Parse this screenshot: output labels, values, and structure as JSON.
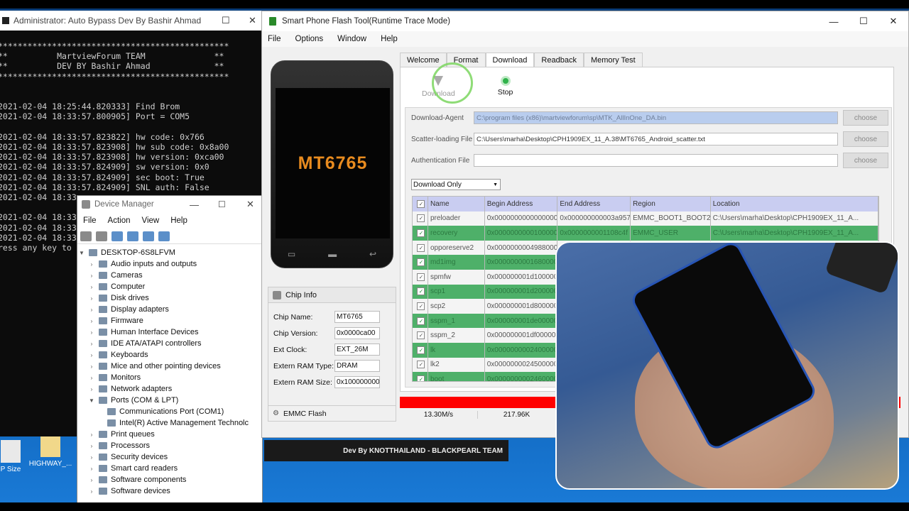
{
  "console": {
    "title": "Administrator: Auto Bypass Dev By Bashir Ahmad",
    "lines": [
      "***********************************************",
      "**          MartviewForum TEAM              **",
      "**          DEV BY Bashir Ahmad             **",
      "***********************************************",
      "",
      "",
      "2021-02-04 18:25:44.820333] Find Brom",
      "2021-02-04 18:33:57.800905] Port = COM5",
      "",
      "2021-02-04 18:33:57.823822] hw code: 0x766",
      "2021-02-04 18:33:57.823908] hw sub code: 0x8a00",
      "2021-02-04 18:33:57.823908] hw version: 0xca00",
      "2021-02-04 18:33:57.824909] sw version: 0x0",
      "2021-02-04 18:33:57.824909] sec boot: True",
      "2021-02-04 18:33:57.824909] SNL auth: False",
      "2021-02-04 18:33",
      "",
      "2021-02-04 18:33",
      "2021-02-04 18:33",
      "2021-02-04 18:33",
      "ress any key to"
    ]
  },
  "devmgr": {
    "title": "Device Manager",
    "menu": [
      "File",
      "Action",
      "View",
      "Help"
    ],
    "root": "DESKTOP-6S8LFVM",
    "items": [
      {
        "label": "Audio inputs and outputs",
        "expanded": false
      },
      {
        "label": "Cameras",
        "expanded": false
      },
      {
        "label": "Computer",
        "expanded": false
      },
      {
        "label": "Disk drives",
        "expanded": false
      },
      {
        "label": "Display adapters",
        "expanded": false
      },
      {
        "label": "Firmware",
        "expanded": false
      },
      {
        "label": "Human Interface Devices",
        "expanded": false
      },
      {
        "label": "IDE ATA/ATAPI controllers",
        "expanded": false
      },
      {
        "label": "Keyboards",
        "expanded": false
      },
      {
        "label": "Mice and other pointing devices",
        "expanded": false
      },
      {
        "label": "Monitors",
        "expanded": false
      },
      {
        "label": "Network adapters",
        "expanded": false
      },
      {
        "label": "Ports (COM & LPT)",
        "expanded": true
      },
      {
        "label": "Communications Port (COM1)",
        "child": true
      },
      {
        "label": "Intel(R) Active Management Technolc",
        "child": true
      },
      {
        "label": "Print queues",
        "expanded": false
      },
      {
        "label": "Processors",
        "expanded": false
      },
      {
        "label": "Security devices",
        "expanded": false
      },
      {
        "label": "Smart card readers",
        "expanded": false
      },
      {
        "label": "Software components",
        "expanded": false
      },
      {
        "label": "Software devices",
        "expanded": false
      }
    ]
  },
  "flash": {
    "title": "Smart Phone Flash Tool(Runtime Trace Mode)",
    "menu": [
      "File",
      "Options",
      "Window",
      "Help"
    ],
    "phone_chip": "MT6765",
    "tabs": [
      "Welcome",
      "Format",
      "Download",
      "Readback",
      "Memory Test"
    ],
    "active_tab": "Download",
    "actions": {
      "download": "Download",
      "stop": "Stop"
    },
    "fields": {
      "download_agent_label": "Download-Agent",
      "download_agent_value": "C:\\program files (x86)\\martviewforum\\sp\\MTK_AllInOne_DA.bin",
      "scatter_label": "Scatter-loading File",
      "scatter_value": "C:\\Users\\marha\\Desktop\\CPH1909EX_11_A.38\\MT6765_Android_scatter.txt",
      "auth_label": "Authentication File",
      "auth_value": "",
      "choose": "choose"
    },
    "mode": "Download Only",
    "columns": [
      "Name",
      "Begin Address",
      "End Address",
      "Region",
      "Location"
    ],
    "rows": [
      {
        "name": "preloader",
        "begin": "0x0000000000000000",
        "end": "0x000000000003a957",
        "region": "EMMC_BOOT1_BOOT2",
        "loc": "C:\\Users\\marha\\Desktop\\CPH1909EX_11_A...",
        "g": false
      },
      {
        "name": "recovery",
        "begin": "0x0000000000100000",
        "end": "0x0000000001108c4f",
        "region": "EMMC_USER",
        "loc": "C:\\Users\\marha\\Desktop\\CPH1909EX_11_A...",
        "g": true
      },
      {
        "name": "opporeserve2",
        "begin": "0x0000000004988000",
        "end": "",
        "region": "",
        "loc": "",
        "g": false
      },
      {
        "name": "md1img",
        "begin": "0x00000000016800000",
        "end": "",
        "region": "",
        "loc": "",
        "g": true
      },
      {
        "name": "spmfw",
        "begin": "0x000000001d100000",
        "end": "",
        "region": "",
        "loc": "",
        "g": false
      },
      {
        "name": "scp1",
        "begin": "0x000000001d200000",
        "end": "",
        "region": "",
        "loc": "",
        "g": true
      },
      {
        "name": "scp2",
        "begin": "0x000000001d800000",
        "end": "",
        "region": "",
        "loc": "",
        "g": false
      },
      {
        "name": "sspm_1",
        "begin": "0x000000001de00000",
        "end": "",
        "region": "",
        "loc": "",
        "g": true
      },
      {
        "name": "sspm_2",
        "begin": "0x000000001df00000",
        "end": "",
        "region": "",
        "loc": "",
        "g": false
      },
      {
        "name": "lk",
        "begin": "0x0000000002400000",
        "end": "",
        "region": "",
        "loc": "",
        "g": true
      },
      {
        "name": "lk2",
        "begin": "0x0000000024500000",
        "end": "",
        "region": "",
        "loc": "",
        "g": false
      },
      {
        "name": "boot",
        "begin": "0x0000000002460000",
        "end": "",
        "region": "",
        "loc": "",
        "g": true
      }
    ],
    "chip_info": {
      "header": "Chip Info",
      "rows": [
        {
          "label": "Chip Name:",
          "value": "MT6765"
        },
        {
          "label": "Chip Version:",
          "value": "0x0000ca00"
        },
        {
          "label": "Ext Clock:",
          "value": "EXT_26M"
        },
        {
          "label": "Extern RAM Type:",
          "value": "DRAM"
        },
        {
          "label": "Extern RAM Size:",
          "value": "0x100000000"
        }
      ],
      "footer": "EMMC Flash"
    },
    "status": {
      "speed": "13.30M/s",
      "size": "217.96K"
    },
    "progress_color": "#ff0000"
  },
  "banner": "Dev By KNOTTHAILAND - BLACKPEARL TEAM",
  "desktop_icons": [
    {
      "label": "P Size"
    },
    {
      "label": "HIGHWAY_..."
    }
  ]
}
